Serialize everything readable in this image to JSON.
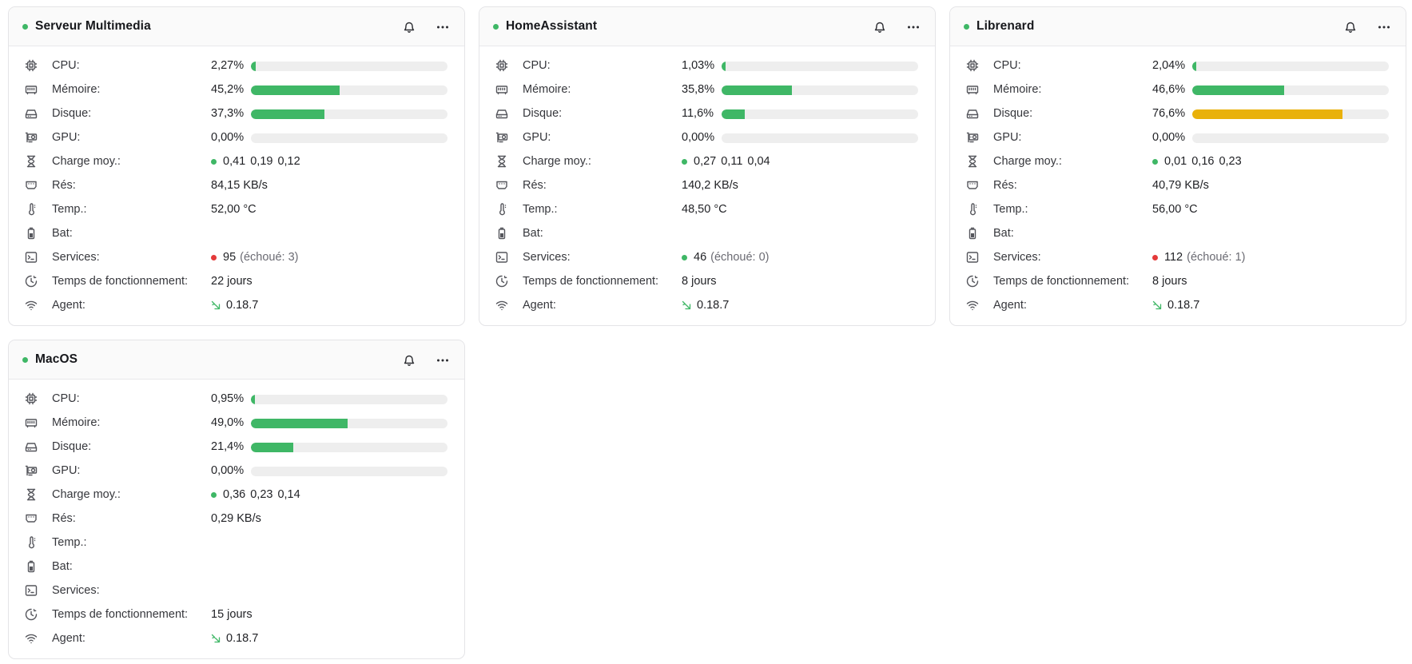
{
  "labels": {
    "cpu": "CPU:",
    "memory": "Mémoire:",
    "disk": "Disque:",
    "gpu": "GPU:",
    "load": "Charge moy.:",
    "net": "Rés:",
    "temp": "Temp.:",
    "bat": "Bat:",
    "services": "Services:",
    "uptime": "Temps de fonctionnement:",
    "agent": "Agent:"
  },
  "colors": {
    "ok": "#3fb766",
    "warn": "#e9b10a",
    "error": "#e43a3a",
    "track": "#eeeeee"
  },
  "icons": {
    "header": [
      "bell-icon",
      "more-horizontal-icon"
    ],
    "rows": [
      "cpu-icon",
      "memory-icon",
      "hard-drive-icon",
      "gpu-icon",
      "hourglass-icon",
      "network-icon",
      "thermometer-icon",
      "battery-icon",
      "terminal-icon",
      "clock-icon",
      "wifi-icon",
      "agent-leaf-icon"
    ]
  },
  "systems": [
    {
      "name": "Serveur Multimedia",
      "status": "up",
      "cpu": {
        "text": "2,27%",
        "pct": 2.27,
        "level": "ok"
      },
      "memory": {
        "text": "45,2%",
        "pct": 45.2,
        "level": "ok"
      },
      "disk": {
        "text": "37,3%",
        "pct": 37.3,
        "level": "ok"
      },
      "gpu": {
        "text": "0,00%",
        "pct": 0,
        "level": "ok"
      },
      "load": {
        "status": "green",
        "values": [
          "0,41",
          "0,19",
          "0,12"
        ]
      },
      "net": "84,15 KB/s",
      "temp": "52,00 °C",
      "bat": "",
      "services": {
        "count": "95",
        "failed": "(échoué: 3)",
        "status": "red"
      },
      "uptime": "22 jours",
      "agent": "0.18.7"
    },
    {
      "name": "HomeAssistant",
      "status": "up",
      "cpu": {
        "text": "1,03%",
        "pct": 1.03,
        "level": "ok"
      },
      "memory": {
        "text": "35,8%",
        "pct": 35.8,
        "level": "ok"
      },
      "disk": {
        "text": "11,6%",
        "pct": 11.6,
        "level": "ok"
      },
      "gpu": {
        "text": "0,00%",
        "pct": 0,
        "level": "ok"
      },
      "load": {
        "status": "green",
        "values": [
          "0,27",
          "0,11",
          "0,04"
        ]
      },
      "net": "140,2 KB/s",
      "temp": "48,50 °C",
      "bat": "",
      "services": {
        "count": "46",
        "failed": "(échoué: 0)",
        "status": "green"
      },
      "uptime": "8 jours",
      "agent": "0.18.7"
    },
    {
      "name": "Librenard",
      "status": "up",
      "cpu": {
        "text": "2,04%",
        "pct": 2.04,
        "level": "ok"
      },
      "memory": {
        "text": "46,6%",
        "pct": 46.6,
        "level": "ok"
      },
      "disk": {
        "text": "76,6%",
        "pct": 76.6,
        "level": "warn"
      },
      "gpu": {
        "text": "0,00%",
        "pct": 0,
        "level": "ok"
      },
      "load": {
        "status": "green",
        "values": [
          "0,01",
          "0,16",
          "0,23"
        ]
      },
      "net": "40,79 KB/s",
      "temp": "56,00 °C",
      "bat": "",
      "services": {
        "count": "112",
        "failed": "(échoué: 1)",
        "status": "red"
      },
      "uptime": "8 jours",
      "agent": "0.18.7"
    },
    {
      "name": "MacOS",
      "status": "up",
      "cpu": {
        "text": "0,95%",
        "pct": 0.95,
        "level": "ok"
      },
      "memory": {
        "text": "49,0%",
        "pct": 49.0,
        "level": "ok"
      },
      "disk": {
        "text": "21,4%",
        "pct": 21.4,
        "level": "ok"
      },
      "gpu": {
        "text": "0,00%",
        "pct": 0,
        "level": "ok"
      },
      "load": {
        "status": "green",
        "values": [
          "0,36",
          "0,23",
          "0,14"
        ]
      },
      "net": "0,29 KB/s",
      "temp": "",
      "bat": "",
      "services": {
        "count": "",
        "failed": "",
        "status": ""
      },
      "uptime": "15 jours",
      "agent": "0.18.7"
    }
  ]
}
